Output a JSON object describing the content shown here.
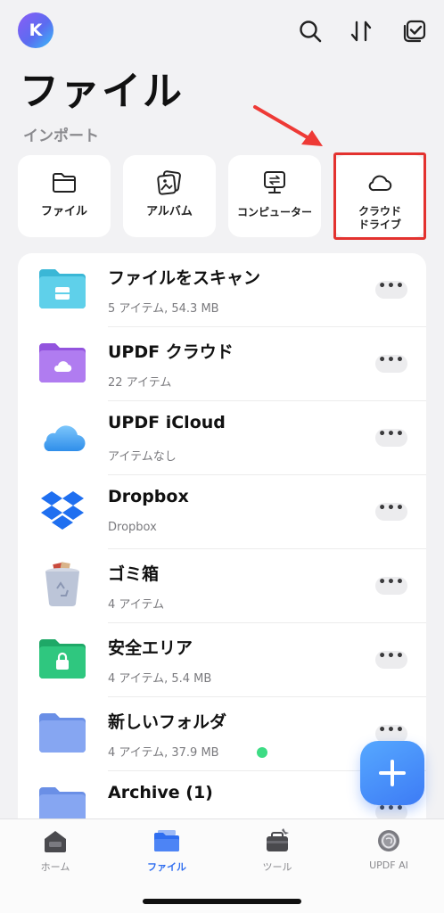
{
  "header": {
    "avatar_initial": "K",
    "title": "ファイル",
    "icons": [
      "search-icon",
      "sort-icon",
      "select-icon"
    ]
  },
  "import": {
    "section_label": "インポート",
    "items": [
      {
        "label": "ファイル",
        "icon": "folder-icon"
      },
      {
        "label": "アルバム",
        "icon": "photo-album-icon"
      },
      {
        "label": "コンピューター",
        "icon": "computer-icon"
      },
      {
        "label_line1": "クラウド",
        "label_line2": "ドライブ",
        "icon": "cloud-icon"
      }
    ]
  },
  "files": [
    {
      "name": "ファイルをスキャン",
      "sub": "5 アイテム, 54.3 MB",
      "icon": "scan-folder-icon",
      "color": "#4cc3dd"
    },
    {
      "name": "UPDF クラウド",
      "sub": "22 アイテム",
      "icon": "cloud-folder-icon",
      "color": "#a76ee6"
    },
    {
      "name": "UPDF iCloud",
      "sub": "アイテムなし",
      "icon": "icloud-icon",
      "color": "#4aa6f0"
    },
    {
      "name": "Dropbox",
      "sub": "Dropbox",
      "icon": "dropbox-icon",
      "color": "#1f6ff0"
    },
    {
      "name": "ゴミ箱",
      "sub": "4 アイテム",
      "icon": "trash-icon",
      "color": "#a9b4cc"
    },
    {
      "name": "安全エリア",
      "sub": "4 アイテム, 5.4 MB",
      "icon": "lock-folder-icon",
      "color": "#27c07a"
    },
    {
      "name": "新しいフォルダ",
      "sub": "4 アイテム, 37.9 MB",
      "icon": "folder-icon",
      "color": "#7da2ee"
    },
    {
      "name": "Archive (1)",
      "sub": "",
      "icon": "folder-icon",
      "color": "#7da2ee"
    }
  ],
  "more_label": "•••",
  "tabs": [
    {
      "label": "ホーム",
      "icon": "home-icon"
    },
    {
      "label": "ファイル",
      "icon": "files-icon",
      "active": true
    },
    {
      "label": "ツール",
      "icon": "tools-icon"
    },
    {
      "label": "UPDF AI",
      "icon": "ai-icon"
    }
  ],
  "colors": {
    "accent": "#2f6ef0",
    "highlight": "#e3322f",
    "fab": "#3d7bf5"
  }
}
